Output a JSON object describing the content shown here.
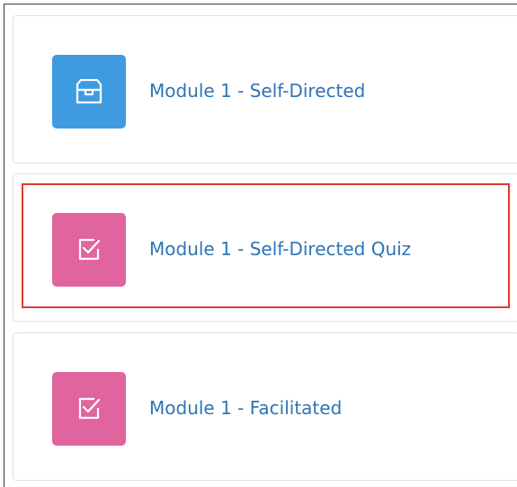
{
  "colors": {
    "accent_blue": "#3e9be0",
    "accent_pink": "#e0649e",
    "link": "#2f74b5",
    "highlight_border": "#e4372a"
  },
  "modules": [
    {
      "title": "Module 1 - Self-Directed",
      "icon": "box-icon",
      "icon_color": "#3e9be0"
    },
    {
      "title": "Module 1 - Self-Directed Quiz",
      "icon": "checkbox-icon",
      "icon_color": "#e0649e",
      "highlighted": true
    },
    {
      "title": "Module 1 - Facilitated",
      "icon": "checkbox-icon",
      "icon_color": "#e0649e"
    }
  ]
}
